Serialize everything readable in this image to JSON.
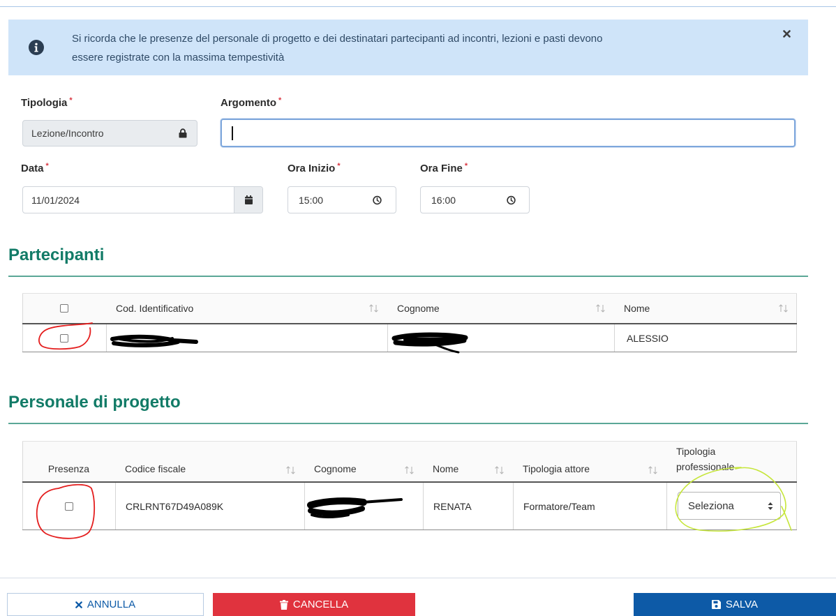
{
  "colors": {
    "accent": "#127b67",
    "alert_bg": "#cfe4f9",
    "alert_text": "#2f4a66",
    "primary": "#0d5aa7",
    "danger": "#e0333e",
    "required_mark": "#d93540",
    "annotation_red": "#e41e1e",
    "annotation_yellow": "#c6e63a"
  },
  "alert": {
    "icon": "info-icon",
    "close_icon": "close-icon",
    "lines": [
      "Si ricorda che le presenze del personale di progetto e dei destinatari partecipanti ad incontri, lezioni e pasti devono",
      "essere registrate con la massima tempestività"
    ]
  },
  "form": {
    "tipologia": {
      "label": "Tipologia",
      "required": "*",
      "value": "Lezione/Incontro",
      "icon": "lock-icon",
      "locked": true
    },
    "argomento": {
      "label": "Argomento",
      "required": "*",
      "value": ""
    },
    "data": {
      "label": "Data",
      "required": "*",
      "value": "11/01/2024",
      "icon": "calendar-icon"
    },
    "ora_inizio": {
      "label": "Ora Inizio",
      "required": "*",
      "value": "15:00",
      "icon": "clock-icon"
    },
    "ora_fine": {
      "label": "Ora Fine",
      "required": "*",
      "value": "16:00",
      "icon": "clock-icon"
    }
  },
  "partecipanti": {
    "title": "Partecipanti",
    "select_all_checked": false,
    "sort_icon": "sort-icon",
    "columns": [
      "Cod. Identificativo",
      "Cognome",
      "Nome"
    ],
    "rows": [
      {
        "checked": false,
        "nome": "ALESSIO"
      }
    ]
  },
  "personale": {
    "title": "Personale di progetto",
    "sort_icon": "sort-icon",
    "columns": [
      "Presenza",
      "Codice fiscale",
      "Cognome",
      "Nome",
      "Tipologia attore",
      "Tipologia professionale"
    ],
    "rows": [
      {
        "presenza": false,
        "codice_fiscale": "CRLRNT67D49A089K",
        "nome": "RENATA",
        "tipologia_attore": "Formatore/Team",
        "tipologia_professionale": "Seleziona"
      }
    ]
  },
  "actions": {
    "annulla": {
      "label": "ANNULLA",
      "icon": "close-icon"
    },
    "cancella": {
      "label": "CANCELLA",
      "icon": "trash-icon"
    },
    "salva": {
      "label": "SALVA",
      "icon": "floppy-disk-icon"
    }
  }
}
